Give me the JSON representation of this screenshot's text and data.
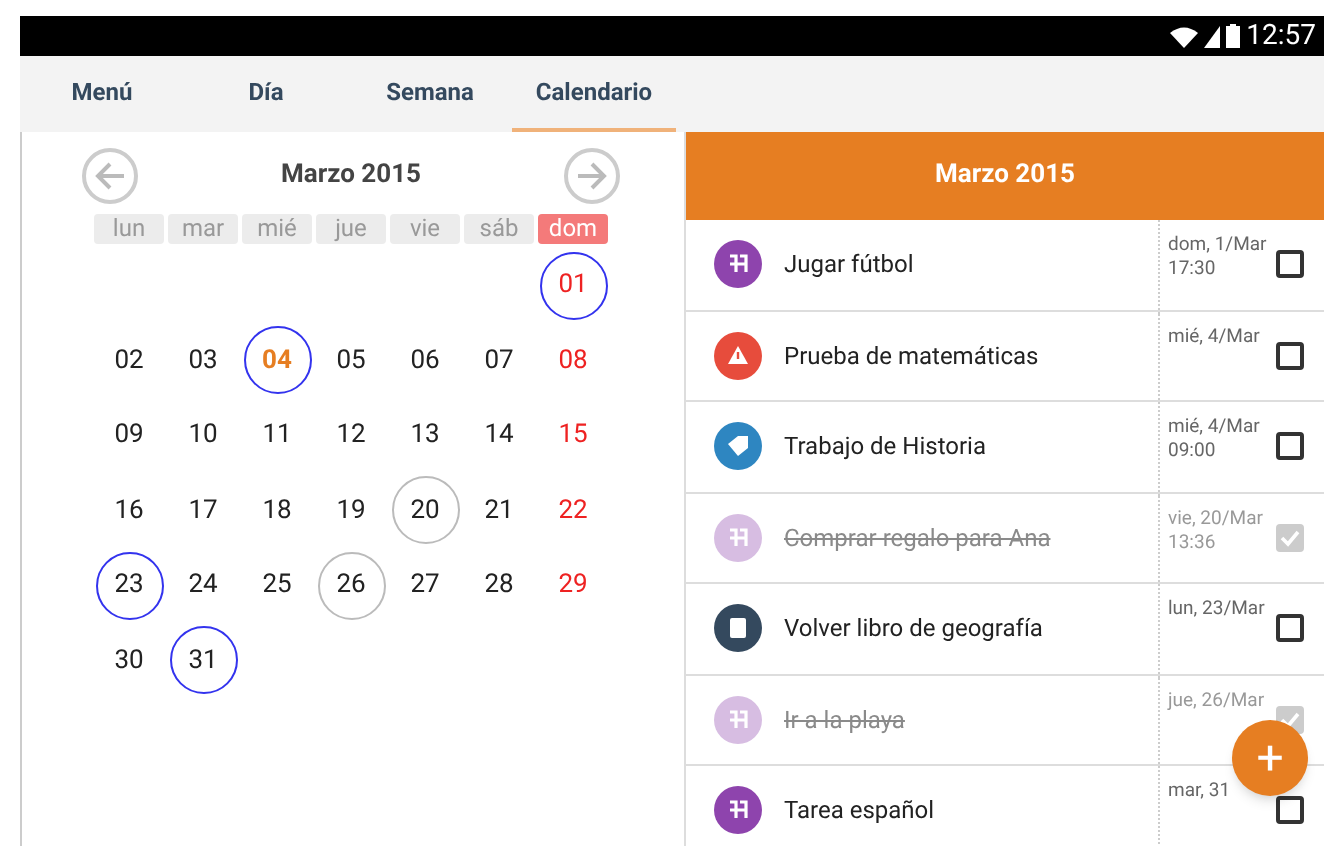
{
  "status_bar": {
    "time": "12:57"
  },
  "tabs": [
    {
      "label": "Menú",
      "selected": false
    },
    {
      "label": "Día",
      "selected": false
    },
    {
      "label": "Semana",
      "selected": false
    },
    {
      "label": "Calendario",
      "selected": true
    }
  ],
  "calendar": {
    "title": "Marzo 2015",
    "weekdays": [
      {
        "label": "lun",
        "selected": false
      },
      {
        "label": "mar",
        "selected": false
      },
      {
        "label": "mié",
        "selected": false
      },
      {
        "label": "jue",
        "selected": false
      },
      {
        "label": "vie",
        "selected": false
      },
      {
        "label": "sáb",
        "selected": false
      },
      {
        "label": "dom",
        "selected": true
      }
    ],
    "weeks": [
      [
        {
          "kind": "empty"
        },
        {
          "kind": "empty"
        },
        {
          "kind": "empty"
        },
        {
          "kind": "empty"
        },
        {
          "kind": "empty"
        },
        {
          "kind": "empty"
        },
        {
          "kind": "event",
          "text": "01",
          "today": false
        }
      ],
      [
        {
          "kind": "plain",
          "text": "02",
          "today": false
        },
        {
          "kind": "plain",
          "text": "03",
          "today": false
        },
        {
          "kind": "event",
          "text": "04",
          "today": true
        },
        {
          "kind": "plain",
          "text": "05",
          "today": false
        },
        {
          "kind": "plain",
          "text": "06",
          "today": false
        },
        {
          "kind": "plain",
          "text": "07",
          "today": false
        },
        {
          "kind": "plain",
          "text": "08",
          "today": false
        }
      ],
      [
        {
          "kind": "plain",
          "text": "09",
          "today": false
        },
        {
          "kind": "plain",
          "text": "10",
          "today": false
        },
        {
          "kind": "plain",
          "text": "11",
          "today": false
        },
        {
          "kind": "plain",
          "text": "12",
          "today": false
        },
        {
          "kind": "plain",
          "text": "13",
          "today": false
        },
        {
          "kind": "plain",
          "text": "14",
          "today": false
        },
        {
          "kind": "plain",
          "text": "15",
          "today": false
        }
      ],
      [
        {
          "kind": "plain",
          "text": "16",
          "today": false
        },
        {
          "kind": "plain",
          "text": "17",
          "today": false
        },
        {
          "kind": "plain",
          "text": "18",
          "today": false
        },
        {
          "kind": "plain",
          "text": "19",
          "today": false
        },
        {
          "kind": "done",
          "text": "20",
          "today": false
        },
        {
          "kind": "plain",
          "text": "21",
          "today": false
        },
        {
          "kind": "plain",
          "text": "22",
          "today": false
        }
      ],
      [
        {
          "kind": "event",
          "text": "23",
          "today": false
        },
        {
          "kind": "plain",
          "text": "24",
          "today": false
        },
        {
          "kind": "plain",
          "text": "25",
          "today": false
        },
        {
          "kind": "done",
          "text": "26",
          "today": false
        },
        {
          "kind": "plain",
          "text": "27",
          "today": false
        },
        {
          "kind": "plain",
          "text": "28",
          "today": false
        },
        {
          "kind": "plain",
          "text": "29",
          "today": false
        }
      ],
      [
        {
          "kind": "plain",
          "text": "30",
          "today": false
        },
        {
          "kind": "event",
          "text": "31",
          "today": false
        }
      ]
    ]
  },
  "task_list": {
    "title": "Marzo 2015",
    "tasks": [
      {
        "kind": "sport",
        "color": "#8e44ad",
        "title": "Jugar fútbol",
        "date": "dom, 1/Mar",
        "time": "17:30",
        "checked": false
      },
      {
        "kind": "alert",
        "color": "#e74c3c",
        "title": "Prueba de matemáticas",
        "date": "mié, 4/Mar",
        "checked": false
      },
      {
        "kind": "tag",
        "color": "#2e86c1",
        "title": "Trabajo de Historia",
        "date": "mié, 4/Mar",
        "time": "09:00",
        "checked": false
      },
      {
        "kind": "sport",
        "color": "#d7bde2",
        "title": "Comprar regalo para Ana",
        "date": "vie, 20/Mar",
        "time": "13:36",
        "checked": true
      },
      {
        "kind": "book",
        "color": "#34495e",
        "title": "Volver libro de geografía",
        "date": "lun, 23/Mar",
        "checked": false
      },
      {
        "kind": "sport",
        "color": "#d7bde2",
        "title": "Ir a la playa",
        "date": "jue, 26/Mar",
        "checked": true
      },
      {
        "kind": "sport",
        "color": "#8e44ad",
        "title": "Tarea español",
        "date": "mar, 31",
        "checked": false
      }
    ]
  },
  "fab": {
    "label": "+"
  }
}
